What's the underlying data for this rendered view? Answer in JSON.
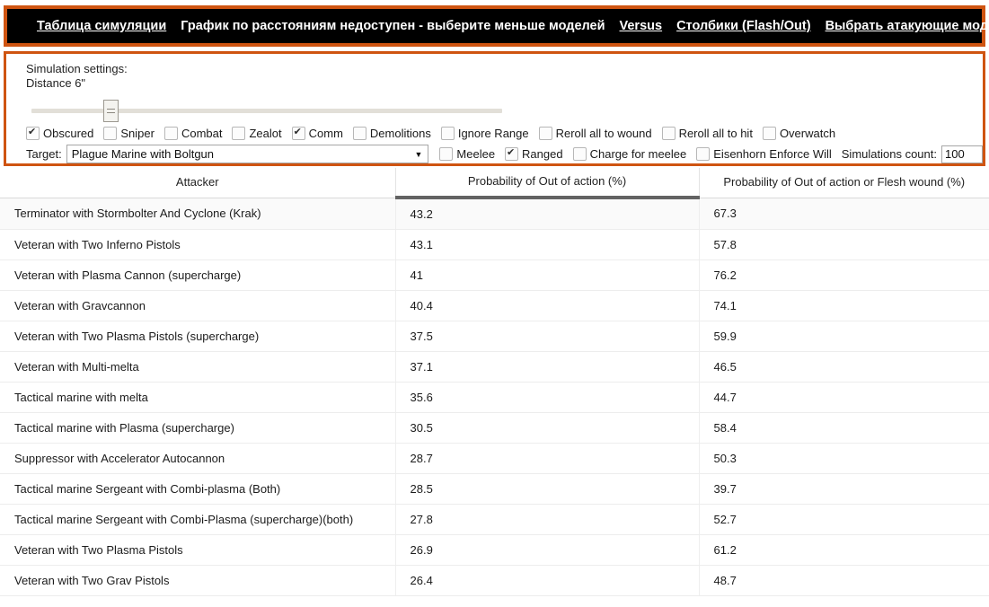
{
  "nav": {
    "items": [
      {
        "label": "Таблица симуляции",
        "link": true
      },
      {
        "label": "График по расстояниям недоступен - выберите меньше моделей",
        "link": false
      },
      {
        "label": "Versus",
        "link": true
      },
      {
        "label": "Столбики (Flash/Out)",
        "link": true
      },
      {
        "label": "Выбрать атакующие модели",
        "link": true
      }
    ]
  },
  "settings": {
    "title": "Simulation settings:",
    "distance_label": "Distance 6\"",
    "slider": {
      "value_pct": 16
    },
    "checkboxes_row1": [
      {
        "label": "Obscured",
        "checked": true
      },
      {
        "label": "Sniper",
        "checked": false
      },
      {
        "label": "Combat",
        "checked": false
      },
      {
        "label": "Zealot",
        "checked": false
      },
      {
        "label": "Comm",
        "checked": true
      },
      {
        "label": "Demolitions",
        "checked": false
      },
      {
        "label": "Ignore Range",
        "checked": false
      },
      {
        "label": "Reroll all to wound",
        "checked": false
      },
      {
        "label": "Reroll all to hit",
        "checked": false
      },
      {
        "label": "Overwatch",
        "checked": false
      }
    ],
    "target_label": "Target:",
    "target_value": "Plague Marine with Boltgun",
    "checkboxes_row2": [
      {
        "label": "Meelee",
        "checked": false
      },
      {
        "label": "Ranged",
        "checked": true
      },
      {
        "label": "Charge for meelee",
        "checked": false
      },
      {
        "label": "Eisenhorn Enforce Will",
        "checked": false
      }
    ],
    "simcount_label": "Simulations count:",
    "simcount_value": "100"
  },
  "table": {
    "headers": [
      {
        "label": "Attacker",
        "sorted": false
      },
      {
        "label": "Probability of Out of action (%)",
        "sorted": true
      },
      {
        "label": "Probability of Out of action or Flesh wound (%)",
        "sorted": false
      }
    ],
    "rows": [
      {
        "attacker": "Terminator with Stormbolter And Cyclone (Krak)",
        "ooa": "43.2",
        "ooa_fw": "67.3"
      },
      {
        "attacker": "Veteran with Two Inferno Pistols",
        "ooa": "43.1",
        "ooa_fw": "57.8"
      },
      {
        "attacker": "Veteran with Plasma Cannon (supercharge)",
        "ooa": "41",
        "ooa_fw": "76.2"
      },
      {
        "attacker": "Veteran with Gravcannon",
        "ooa": "40.4",
        "ooa_fw": "74.1"
      },
      {
        "attacker": "Veteran with Two Plasma Pistols (supercharge)",
        "ooa": "37.5",
        "ooa_fw": "59.9"
      },
      {
        "attacker": "Veteran with Multi-melta",
        "ooa": "37.1",
        "ooa_fw": "46.5"
      },
      {
        "attacker": "Tactical marine with melta",
        "ooa": "35.6",
        "ooa_fw": "44.7"
      },
      {
        "attacker": "Tactical marine with Plasma (supercharge)",
        "ooa": "30.5",
        "ooa_fw": "58.4"
      },
      {
        "attacker": "Suppressor with Accelerator Autocannon",
        "ooa": "28.7",
        "ooa_fw": "50.3"
      },
      {
        "attacker": "Tactical marine Sergeant with Combi-plasma (Both)",
        "ooa": "28.5",
        "ooa_fw": "39.7"
      },
      {
        "attacker": "Tactical marine Sergeant with Combi-Plasma (supercharge)(both)",
        "ooa": "27.8",
        "ooa_fw": "52.7"
      },
      {
        "attacker": "Veteran with Two Plasma Pistols",
        "ooa": "26.9",
        "ooa_fw": "61.2"
      },
      {
        "attacker": "Veteran with Two Grav Pistols",
        "ooa": "26.4",
        "ooa_fw": "48.7"
      }
    ]
  },
  "colors": {
    "accent": "#cf5411",
    "navbar_bg": "#000000",
    "sorted_underline": "#636363"
  }
}
